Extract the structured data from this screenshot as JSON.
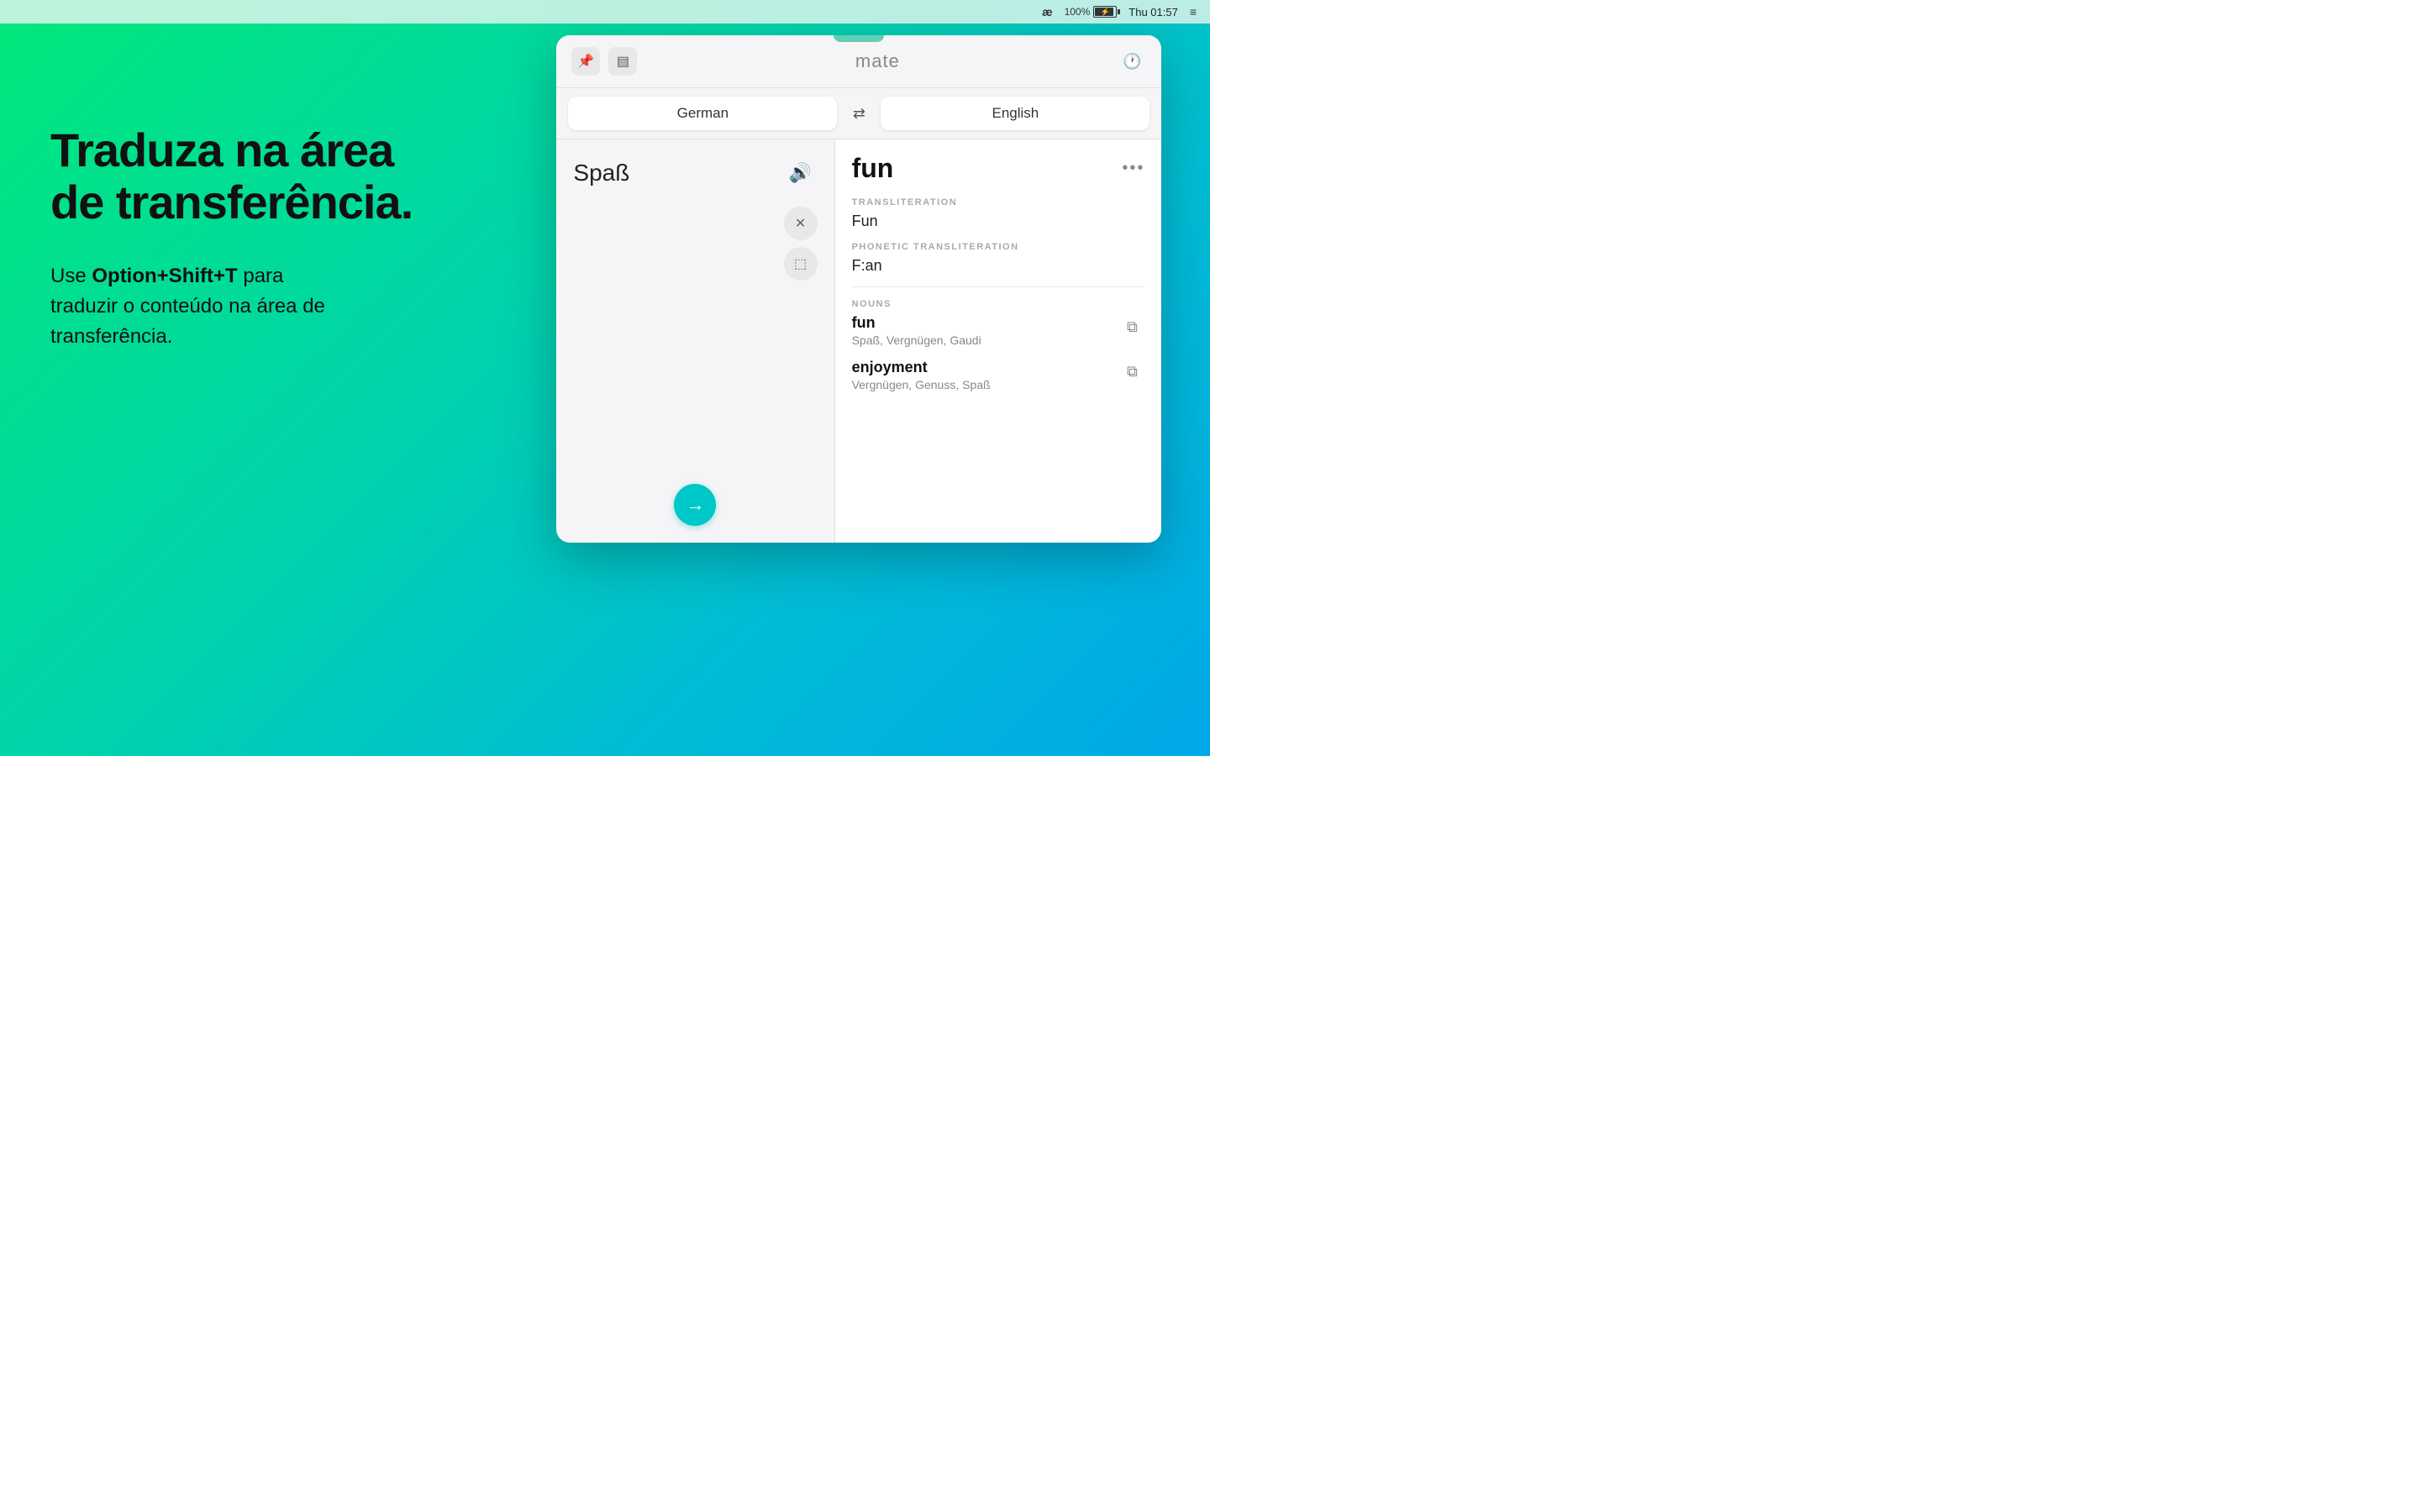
{
  "menubar": {
    "ae_symbol": "æ",
    "battery_percent": "100%",
    "time": "Thu 01:57",
    "list_icon": "≡"
  },
  "background": {
    "headline_line1": "Traduza na área",
    "headline_line2": "de transferência.",
    "subtext_prefix": "Use ",
    "shortcut": "Option+Shift+T",
    "subtext_suffix": " para",
    "subtext_line2": "traduzir o conteúdo na área de",
    "subtext_line3": "transferência."
  },
  "popup": {
    "title": "mate",
    "pin_icon": "📌",
    "notebook_icon": "📋",
    "history_icon": "🕐",
    "source_lang": "German",
    "swap_icon": "⇄",
    "target_lang": "English",
    "source_word": "Spaß",
    "speaker_icon": "🔊",
    "close_icon": "✕",
    "bookmark_icon": "⬚",
    "go_icon": "→",
    "result_word": "fun",
    "more_icon": "•••",
    "transliteration_label": "TRANSLITERATION",
    "transliteration_value": "Fun",
    "phonetic_label": "PHONETIC TRANSLITERATION",
    "phonetic_value": "F:an",
    "nouns_label": "NOUNS",
    "noun1_word": "fun",
    "noun1_sub": "Spaß, Vergnügen, Gaudi",
    "noun2_word": "enjoyment",
    "noun2_sub": "Vergnügen, Genuss, Spaß",
    "copy_icon": "⧉"
  }
}
